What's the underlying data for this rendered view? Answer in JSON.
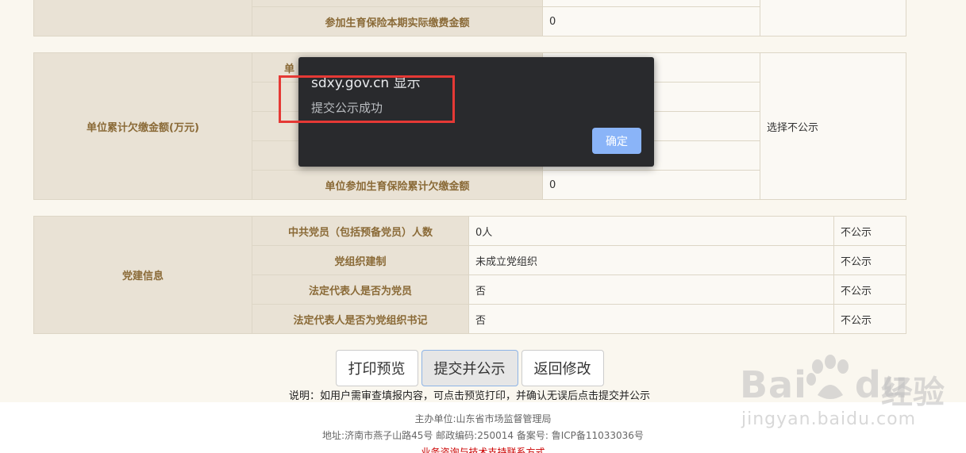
{
  "top_table": {
    "row_label": "参加生育保险本期实际缴费金额",
    "row_value": "0"
  },
  "arrears": {
    "section": "单位累计欠缴金额(万元)",
    "first_label_partial": "单",
    "last_label": "单位参加生育保险累计欠缴金额",
    "last_value": "0",
    "publicity": "选择不公示"
  },
  "party": {
    "section": "党建信息",
    "rows": [
      {
        "label": "中共党员（包括预备党员）人数",
        "value": "0人",
        "publicity": "不公示"
      },
      {
        "label": "党组织建制",
        "value": "未成立党组织",
        "publicity": "不公示"
      },
      {
        "label": "法定代表人是否为党员",
        "value": "否",
        "publicity": "不公示"
      },
      {
        "label": "法定代表人是否为党组织书记",
        "value": "否",
        "publicity": "不公示"
      }
    ]
  },
  "buttons": {
    "print": "打印预览",
    "submit": "提交并公示",
    "back": "返回修改"
  },
  "note": "说明：如用户需审查填报内容，可点击预览打印，并确认无误后点击提交并公示",
  "footer": {
    "host": "主办单位:山东省市场监督管理局",
    "address": "地址:济南市燕子山路45号    邮政编码:250014    备案号: 鲁ICP备11033036号",
    "contact": "业务咨询与技术支持联系方式"
  },
  "dialog": {
    "origin": "sdxy.gov.cn 显示",
    "message": "提交公示成功",
    "ok": "确定"
  },
  "watermark": {
    "brand_latin": "Bai",
    "brand_du": "du",
    "brand_cn": "经验",
    "url": "jingyan.baidu.com"
  },
  "colors": {
    "label_bg": "#e9e2d5",
    "label_text": "#8a6a37",
    "dialog_bg": "#292a2d",
    "ok_button": "#8ab4f8",
    "highlight": "#e53935"
  }
}
